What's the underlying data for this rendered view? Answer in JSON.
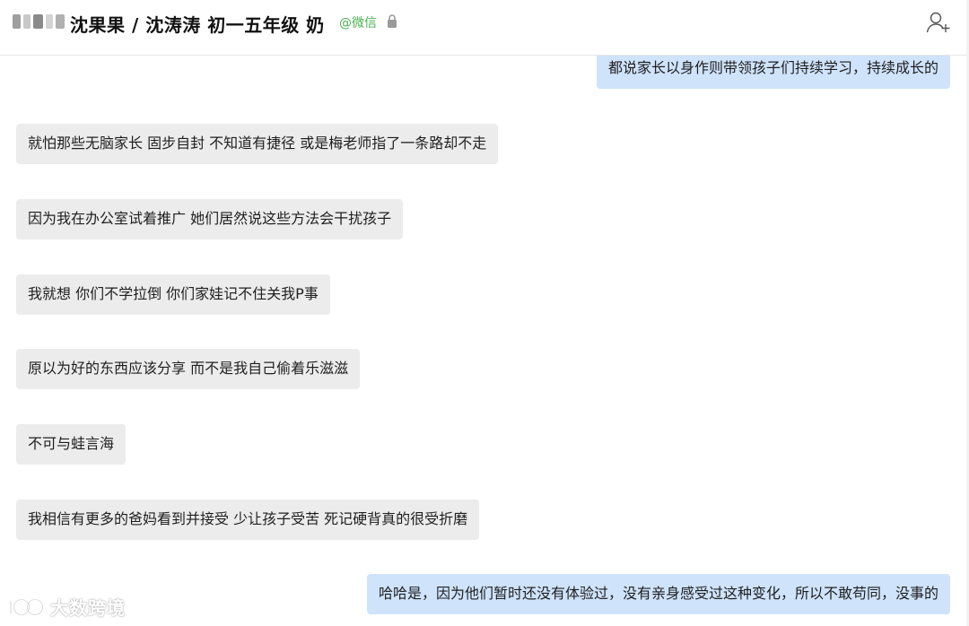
{
  "header": {
    "title": "沈果果 / 沈涛涛 初一五年级 奶",
    "wechat_tag": "@微信",
    "lock_icon": "lock-icon",
    "add_contact_icon": "add-contact-icon"
  },
  "messages": [
    {
      "side": "out",
      "text": "都说家长以身作则带领孩子们持续学习，持续成长的"
    },
    {
      "side": "in",
      "text": "就怕那些无脑家长 固步自封 不知道有捷径 或是梅老师指了一条路却不走"
    },
    {
      "side": "in",
      "text": "因为我在办公室试着推广 她们居然说这些方法会干扰孩子"
    },
    {
      "side": "in",
      "text": "我就想 你们不学拉倒 你们家娃记不住关我P事"
    },
    {
      "side": "in",
      "text": "原以为好的东西应该分享 而不是我自己偷着乐滋滋"
    },
    {
      "side": "in",
      "text": "不可与蛙言海"
    },
    {
      "side": "in",
      "text": "我相信有更多的爸妈看到并接受 少让孩子受苦 死记硬背真的很受折磨"
    },
    {
      "side": "out",
      "text": "哈哈是，因为他们暂时还没有体验过，没有亲身感受过这种变化，所以不敢苟同，没事的"
    }
  ],
  "watermark": {
    "text": "大数跨境",
    "logo_icon": "ioo-logo-icon"
  },
  "colors": {
    "incoming_bubble": "#ececec",
    "outgoing_bubble": "#cfe3fb",
    "wechat_green": "#4caf50"
  }
}
